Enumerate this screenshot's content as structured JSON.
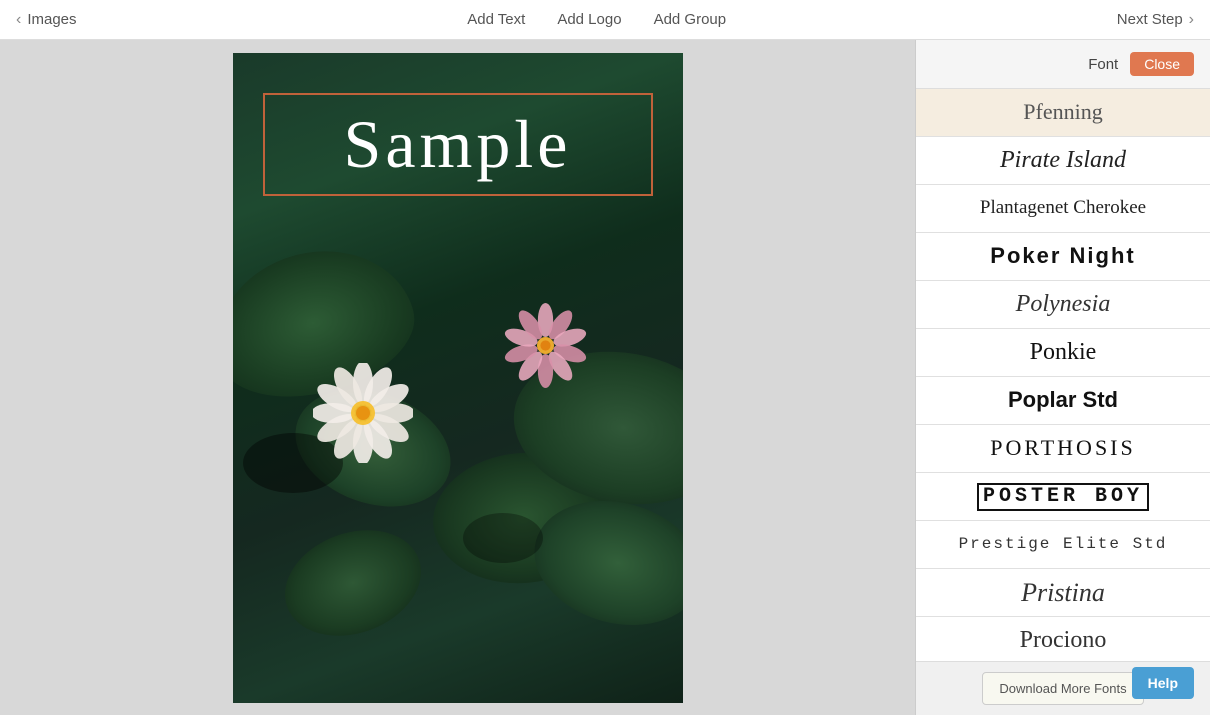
{
  "nav": {
    "back_label": "Images",
    "add_text_label": "Add Text",
    "add_logo_label": "Add Logo",
    "add_group_label": "Add Group",
    "next_step_label": "Next Step"
  },
  "canvas": {
    "sample_text": "Sample"
  },
  "font_panel": {
    "font_label": "Font",
    "close_label": "Close",
    "fonts": [
      {
        "id": "pfenning",
        "label": "Pfenning",
        "class": "font-pfenning",
        "selected": true
      },
      {
        "id": "pirate-island",
        "label": "Pirate Island",
        "class": "font-pirate",
        "selected": false
      },
      {
        "id": "plantagenet",
        "label": "Plantagenet Cherokee",
        "class": "font-plantagenet",
        "selected": false
      },
      {
        "id": "poker-night",
        "label": "Poker Night",
        "class": "font-poker",
        "selected": false
      },
      {
        "id": "polynesia",
        "label": "Polynesia",
        "class": "font-polynesia",
        "selected": false
      },
      {
        "id": "ponkie",
        "label": "Ponkie",
        "class": "font-ponkie",
        "selected": false
      },
      {
        "id": "poplar",
        "label": "Poplar Std",
        "class": "font-poplar",
        "selected": false
      },
      {
        "id": "porthosis",
        "label": "Porthosis",
        "class": "font-porthosis",
        "selected": false
      },
      {
        "id": "posterboy",
        "label": "Poster Boy",
        "class": "font-posterboy",
        "selected": false
      },
      {
        "id": "prestige",
        "label": "Prestige Elite Std",
        "class": "font-prestige",
        "selected": false
      },
      {
        "id": "pristina",
        "label": "Pristina",
        "class": "font-pristina",
        "selected": false
      },
      {
        "id": "prociono",
        "label": "Prociono",
        "class": "font-prociono",
        "selected": false
      }
    ],
    "download_more_label": "Download More Fonts"
  },
  "help": {
    "label": "Help"
  }
}
